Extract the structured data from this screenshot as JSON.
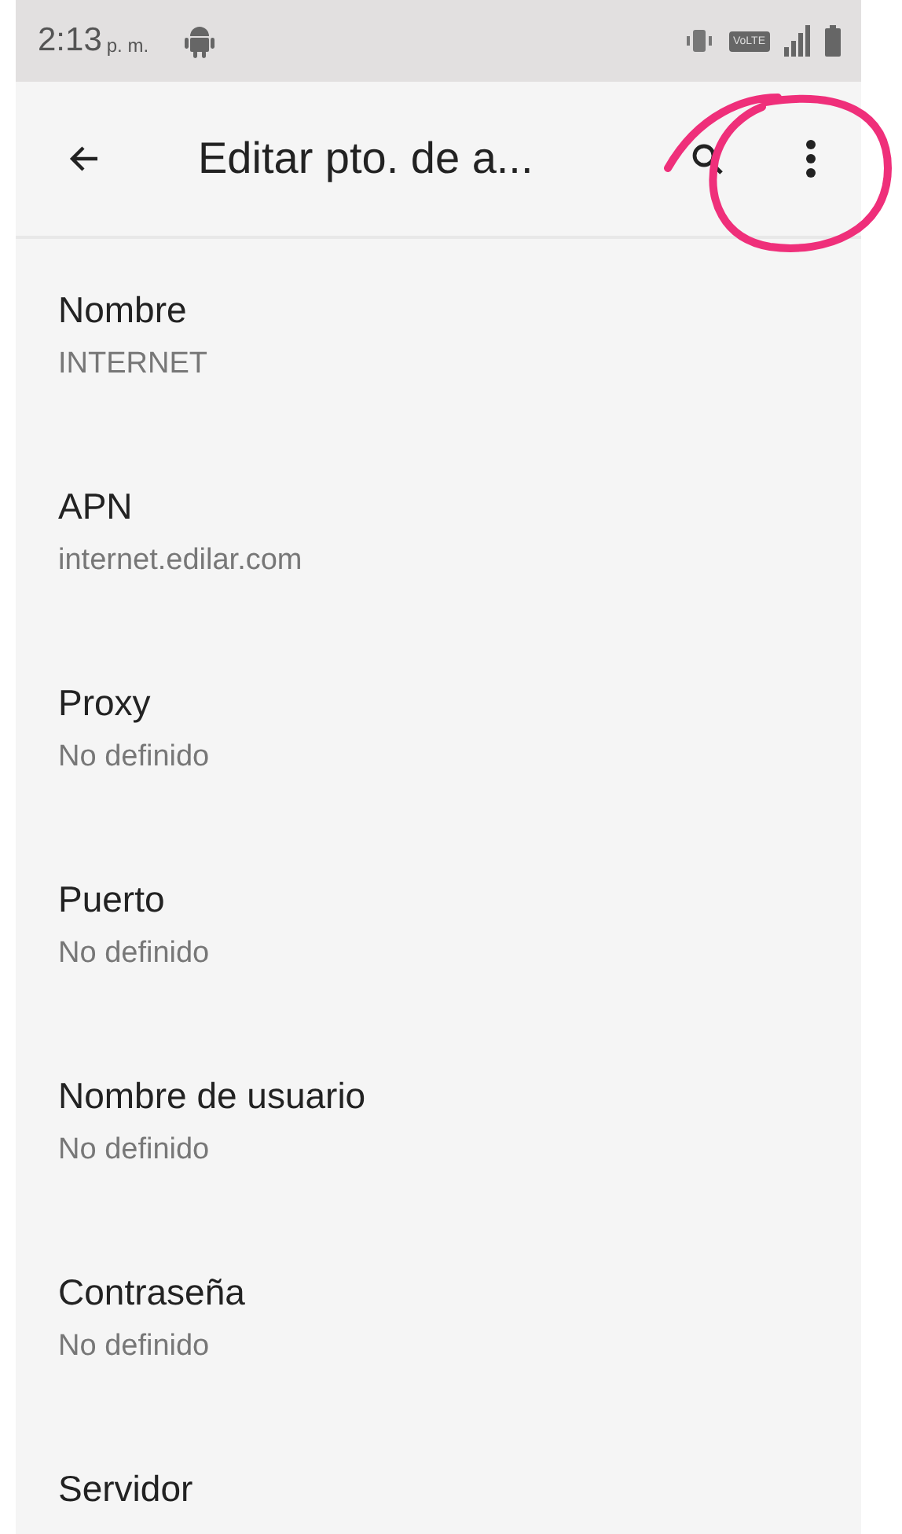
{
  "status_bar": {
    "time": "2:13",
    "period": "p. m.",
    "volte": "VoLTE"
  },
  "toolbar": {
    "title": "Editar pto. de a..."
  },
  "fields": [
    {
      "label": "Nombre",
      "value": "INTERNET"
    },
    {
      "label": "APN",
      "value": "internet.edilar.com"
    },
    {
      "label": "Proxy",
      "value": "No definido"
    },
    {
      "label": "Puerto",
      "value": "No definido"
    },
    {
      "label": "Nombre de usuario",
      "value": "No definido"
    },
    {
      "label": "Contraseña",
      "value": "No definido"
    },
    {
      "label": "Servidor"
    }
  ]
}
